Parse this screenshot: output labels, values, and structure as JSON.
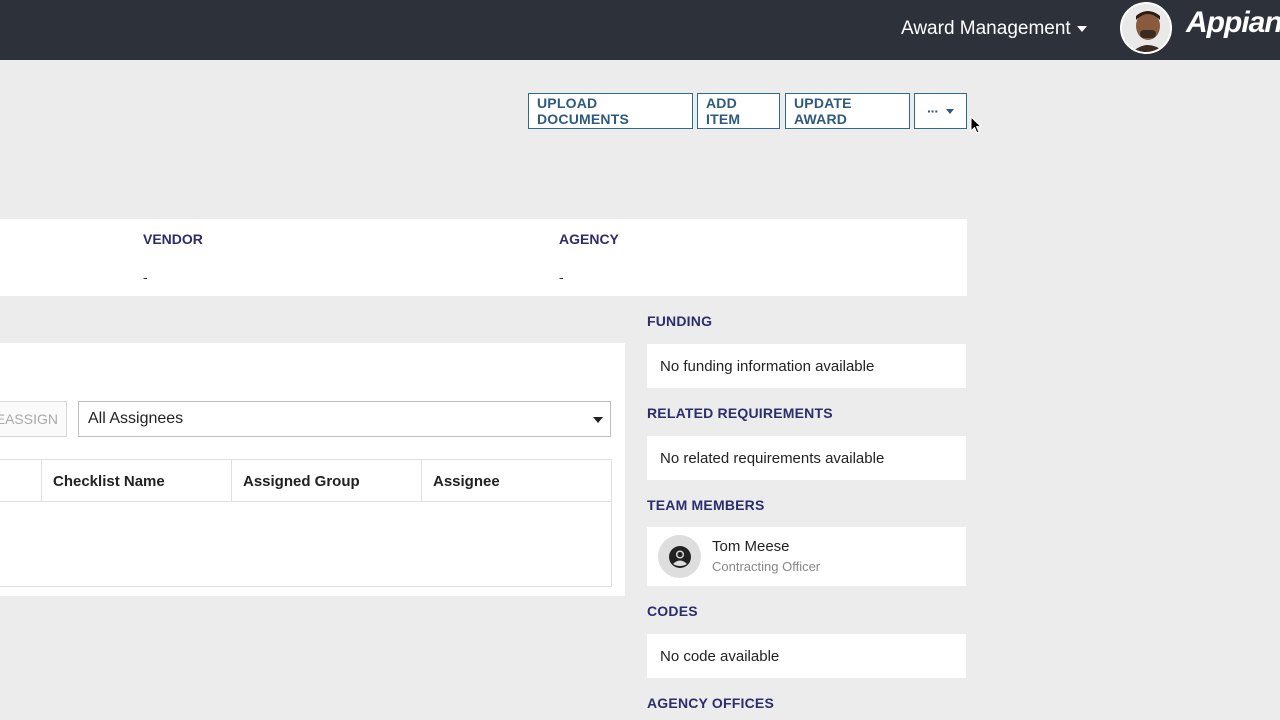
{
  "header": {
    "app_menu_label": "Award Management",
    "brand": "Appian",
    "colors": {
      "bar": "#2d323a",
      "accent": "#2e5a80",
      "section_title": "#2c2d6b"
    }
  },
  "actions": {
    "upload_documents": "UPLOAD DOCUMENTS",
    "add_item": "ADD ITEM",
    "update_award": "UPDATE AWARD",
    "more": "···"
  },
  "summary": {
    "vendor_label": "VENDOR",
    "vendor_value": "-",
    "agency_label": "AGENCY",
    "agency_value": "-"
  },
  "checklist": {
    "reassign_label": "REASSIGN",
    "assignee_filter": "All Assignees",
    "columns": [
      "Checklist Name",
      "Assigned Group",
      "Assignee"
    ]
  },
  "sidebar": {
    "funding_title": "FUNDING",
    "funding_text": "No funding information available",
    "related_title": "RELATED REQUIREMENTS",
    "related_text": "No related requirements available",
    "team_title": "TEAM MEMBERS",
    "team_members": [
      {
        "name": "Tom Meese",
        "role": "Contracting Officer",
        "icon": "user-circle-icon"
      }
    ],
    "codes_title": "CODES",
    "codes_text": "No code available",
    "agency_offices_title": "AGENCY OFFICES"
  }
}
